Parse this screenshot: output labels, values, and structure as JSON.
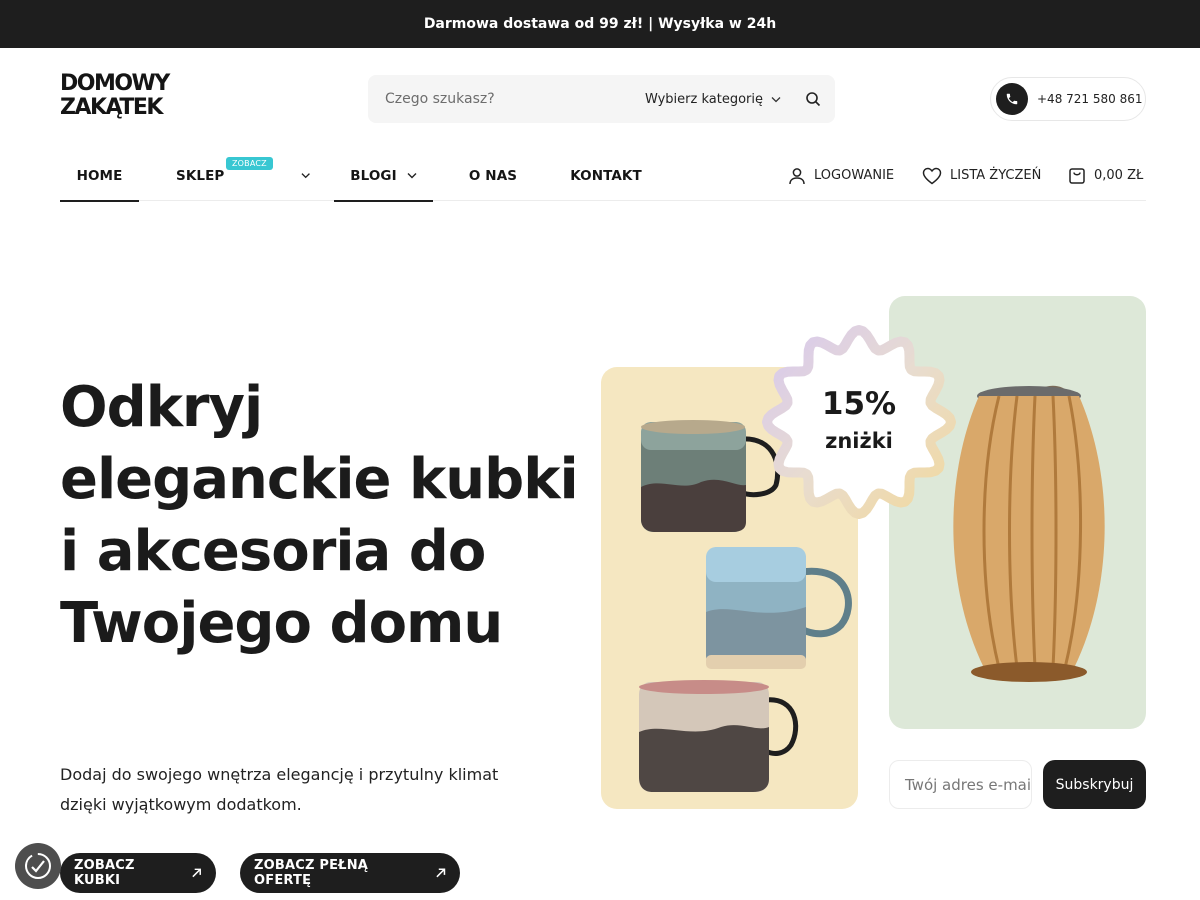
{
  "topbar": {
    "text": "Darmowa dostawa od 99 zł! | Wysyłka w 24h"
  },
  "logo": {
    "line1": "DOMOWY",
    "line2": "ZAKĄTEK"
  },
  "search": {
    "placeholder": "Czego szukasz?",
    "category": "Wybierz kategorię",
    "icon": "search-icon"
  },
  "contact": {
    "phone": "+48 721 580 861",
    "icon": "phone-icon"
  },
  "nav": {
    "items": [
      {
        "label": "HOME",
        "active": true
      },
      {
        "label": "SKLEP",
        "badge": "ZOBACZ",
        "dropdown": true
      },
      {
        "label": "BLOGI",
        "active": true,
        "dropdown": true
      },
      {
        "label": "O NAS"
      },
      {
        "label": "KONTAKT"
      }
    ]
  },
  "account": {
    "login": "LOGOWANIE",
    "wishlist": "LISTA ŻYCZEŃ",
    "cart": "0,00 ZŁ"
  },
  "hero": {
    "title": "Odkryj eleganckie kubki i akcesoria do Twojego domu",
    "subtitle": "Dodaj do swojego wnętrza elegancję i przytulny klimat dzięki wyjątkowym dodatkom.",
    "buttons": [
      "ZOBACZ KUBKI",
      "ZOBACZ PEŁNĄ OFERTĘ"
    ]
  },
  "promo": {
    "value": "15%",
    "label": "zniżki"
  },
  "newsletter": {
    "placeholder": "Twój adres e-mail",
    "button": "Subskrybuj"
  },
  "colors": {
    "dark": "#1e1e1e",
    "badge": "#38c7d2",
    "cardYellow": "#f5e7c1",
    "cardGreen": "#dde8d8"
  }
}
